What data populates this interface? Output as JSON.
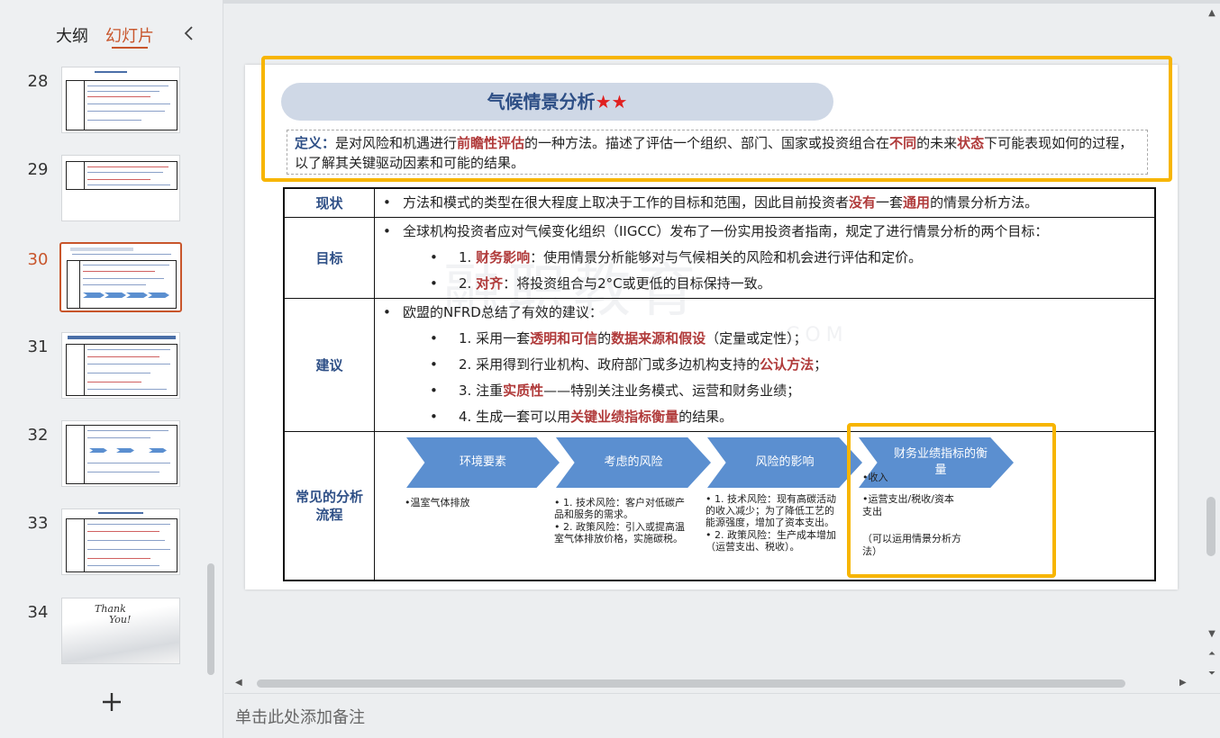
{
  "left_panel": {
    "tabs": {
      "outline": "大纲",
      "slides": "幻灯片"
    },
    "thumbnails": [
      {
        "number": "28"
      },
      {
        "number": "29"
      },
      {
        "number": "30"
      },
      {
        "number": "31"
      },
      {
        "number": "32"
      },
      {
        "number": "33"
      },
      {
        "number": "34"
      }
    ],
    "thank_you_line1": "Thank",
    "thank_you_line2": "You!",
    "add_icon": "plus-icon",
    "collapse_icon": "chevron-left-icon"
  },
  "slide": {
    "title": "气候情景分析",
    "title_stars": "★★",
    "definition": {
      "label": "定义：",
      "t1": "是对风险和机遇进行",
      "h1": "前瞻性评估",
      "t2": "的一种方法。描述了评估一个组织、部门、国家或投资组合在",
      "h2": "不同",
      "t3": "的未来",
      "h3": "状态",
      "t4": "下可能表现如何的过程，以了解其关键驱动因素和可能的结果。"
    },
    "watermark": "融职教育",
    "watermark_sub": "COM",
    "rows": {
      "status": {
        "label": "现状",
        "t1": "方法和模式的类型在很大程度上取决于工作的目标和范围，因此目前投资者",
        "h1": "没有",
        "t2": "一套",
        "h2": "通用",
        "t3": "的情景分析方法。"
      },
      "goal": {
        "label": "目标",
        "intro": "全球机构投资者应对气候变化组织（IIGCC）发布了一份实用投资者指南，规定了进行情景分析的两个目标：",
        "i1_num": "1.",
        "i1_h": "财务影响",
        "i1_t": "：使用情景分析能够对与气候相关的风险和机会进行评估和定价。",
        "i2_num": "2.",
        "i2_h": "对齐",
        "i2_t": "：将投资组合与2°C或更低的目标保持一致。"
      },
      "advice": {
        "label": "建议",
        "intro": "欧盟的NFRD总结了有效的建议：",
        "i1_num": "1.",
        "i1_t1": "采用一套",
        "i1_h1": "透明和可信",
        "i1_t2": "的",
        "i1_h2": "数据来源和假设",
        "i1_t3": "（定量或定性）；",
        "i2_num": "2.",
        "i2_t1": "采用得到行业机构、政府部门或多边机构支持的",
        "i2_h1": "公认方法",
        "i2_t2": "；",
        "i3_num": "3.",
        "i3_t1": "注重",
        "i3_h1": "实质性",
        "i3_t2": "——特别关注业务模式、运营和财务业绩；",
        "i4_num": "4.",
        "i4_t1": "生成一套可以用",
        "i4_h1": "关键业绩指标衡量",
        "i4_t2": "的结果。"
      },
      "process": {
        "label": "常见的分析流程",
        "steps": [
          {
            "title": "环境要素"
          },
          {
            "title": "考虑的风险"
          },
          {
            "title": "风险的影响"
          },
          {
            "title": "财务业绩指标的衡量"
          }
        ],
        "notes": {
          "env": "•温室气体排放",
          "risk1": "• 1. 技术风险：客户对低碳产品和服务的需求。",
          "risk2": "• 2. 政策风险：引入或提高温室气体排放价格，实施碳税。",
          "impact1": "• 1. 技术风险：现有高碳活动的收入减少；为了降低工艺的能源强度，增加了资本支出。",
          "impact2": "• 2. 政策风险：生产成本增加（运营支出、税收）。",
          "fin1": "•收入",
          "fin2": "•运营支出/税收/资本支出",
          "fin3": "（可以运用情景分析方法）"
        }
      }
    }
  },
  "notes": {
    "placeholder": "单击此处添加备注"
  },
  "colors": {
    "accent": "#c8552b",
    "title_blue": "#2e4f86",
    "highlight_red": "#b03a3a",
    "arrow_blue": "#5b8fd0",
    "frame_yellow": "#f7b500"
  }
}
